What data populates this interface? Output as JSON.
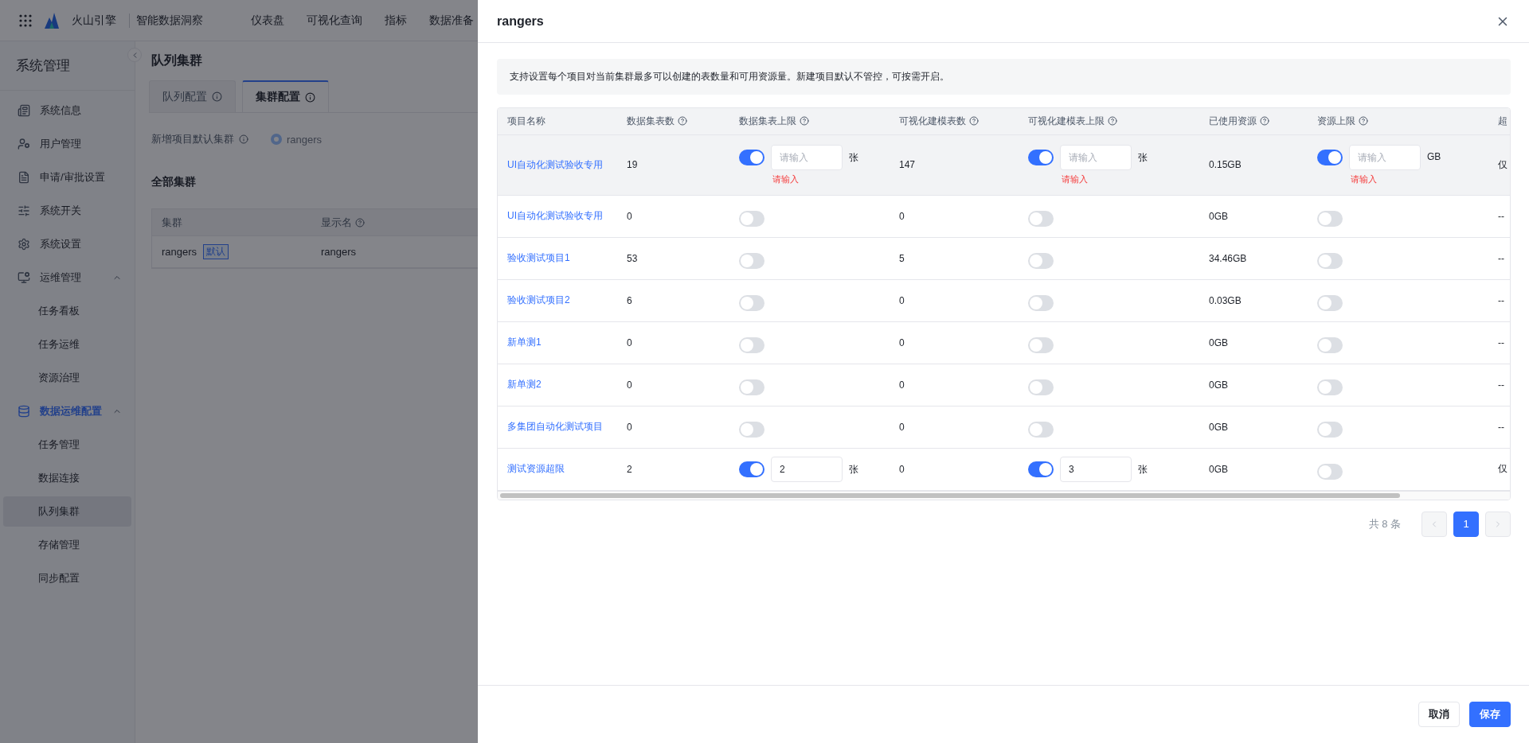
{
  "topbar": {
    "brand": "火山引擎",
    "product": "智能数据洞察",
    "nav": [
      "仪表盘",
      "可视化查询",
      "指标",
      "数据准备"
    ]
  },
  "sidebar": {
    "title": "系统管理",
    "items": [
      {
        "label": "系统信息",
        "selected": false
      },
      {
        "label": "用户管理",
        "selected": false
      },
      {
        "label": "申请/审批设置",
        "selected": false
      },
      {
        "label": "系统开关",
        "selected": false
      },
      {
        "label": "系统设置",
        "selected": false
      },
      {
        "label": "运维管理",
        "expanded": true,
        "active": false,
        "children": [
          {
            "label": "任务看板",
            "selected": false
          },
          {
            "label": "任务运维",
            "selected": false
          },
          {
            "label": "资源治理",
            "selected": false
          }
        ]
      },
      {
        "label": "数据运维配置",
        "expanded": true,
        "active": true,
        "children": [
          {
            "label": "任务管理",
            "selected": false
          },
          {
            "label": "数据连接",
            "selected": false
          },
          {
            "label": "队列集群",
            "selected": true
          },
          {
            "label": "存储管理",
            "selected": false
          },
          {
            "label": "同步配置",
            "selected": false
          }
        ]
      }
    ]
  },
  "main": {
    "title": "队列集群",
    "tabs": [
      {
        "label": "队列配置",
        "selected": false
      },
      {
        "label": "集群配置",
        "selected": true
      }
    ],
    "default_cluster": {
      "label": "新增项目默认集群",
      "options": [
        {
          "label": "rangers",
          "selected": true
        }
      ]
    },
    "section_title": "全部集群",
    "cluster_table": {
      "columns": [
        {
          "label": "集群",
          "help": false
        },
        {
          "label": "显示名",
          "help": true
        }
      ],
      "rows": [
        {
          "name": "rangers",
          "tag": "默认",
          "display_name": "rangers"
        }
      ]
    }
  },
  "drawer": {
    "title": "rangers",
    "notice": "支持设置每个项目对当前集群最多可以创建的表数量和可用资源量。新建项目默认不管控，可按需开启。",
    "table": {
      "columns": [
        {
          "label": "项目名称",
          "help": false
        },
        {
          "label": "数据集表数",
          "help": true
        },
        {
          "label": "数据集表上限",
          "help": true
        },
        {
          "label": "可视化建模表数",
          "help": true
        },
        {
          "label": "可视化建模表上限",
          "help": true
        },
        {
          "label": "已使用资源",
          "help": true
        },
        {
          "label": "资源上限",
          "help": true
        },
        {
          "label": "超"
        }
      ],
      "rows": [
        {
          "name": "UI自动化测试验收专用",
          "highlighted": true,
          "dataset_count": "19",
          "dataset_limit": {
            "on": true,
            "placeholder": "请输入",
            "unit": "张",
            "error": "请输入"
          },
          "model_count": "147",
          "model_limit": {
            "on": true,
            "placeholder": "请输入",
            "unit": "张",
            "error": "请输入"
          },
          "used": "0.15GB",
          "resource_limit": {
            "on": true,
            "placeholder": "请输入",
            "unit": "GB",
            "error": "请输入"
          },
          "column_8": "仅"
        },
        {
          "name": "UI自动化测试验收专用",
          "highlighted": false,
          "dataset_count": "0",
          "dataset_limit": {
            "on": false
          },
          "model_count": "0",
          "model_limit": {
            "on": false
          },
          "used": "0GB",
          "resource_limit": {
            "on": false
          },
          "column_8": "--"
        },
        {
          "name": "验收测试项目1",
          "highlighted": false,
          "dataset_count": "53",
          "dataset_limit": {
            "on": false
          },
          "model_count": "5",
          "model_limit": {
            "on": false
          },
          "used": "34.46GB",
          "resource_limit": {
            "on": false
          },
          "column_8": "--"
        },
        {
          "name": "验收测试项目2",
          "highlighted": false,
          "dataset_count": "6",
          "dataset_limit": {
            "on": false
          },
          "model_count": "0",
          "model_limit": {
            "on": false
          },
          "used": "0.03GB",
          "resource_limit": {
            "on": false
          },
          "column_8": "--"
        },
        {
          "name": "新单测1",
          "highlighted": false,
          "dataset_count": "0",
          "dataset_limit": {
            "on": false
          },
          "model_count": "0",
          "model_limit": {
            "on": false
          },
          "used": "0GB",
          "resource_limit": {
            "on": false
          },
          "column_8": "--"
        },
        {
          "name": "新单测2",
          "highlighted": false,
          "dataset_count": "0",
          "dataset_limit": {
            "on": false
          },
          "model_count": "0",
          "model_limit": {
            "on": false
          },
          "used": "0GB",
          "resource_limit": {
            "on": false
          },
          "column_8": "--"
        },
        {
          "name": "多集团自动化测试项目",
          "highlighted": false,
          "dataset_count": "0",
          "dataset_limit": {
            "on": false
          },
          "model_count": "0",
          "model_limit": {
            "on": false
          },
          "used": "0GB",
          "resource_limit": {
            "on": false
          },
          "column_8": "--"
        },
        {
          "name": "测试资源超限",
          "highlighted": false,
          "dataset_count": "2",
          "dataset_limit": {
            "on": true,
            "value": "2",
            "unit": "张"
          },
          "model_count": "0",
          "model_limit": {
            "on": true,
            "value": "3",
            "unit": "张"
          },
          "used": "0GB",
          "resource_limit": {
            "on": false
          },
          "column_8": "仅"
        }
      ]
    },
    "pagination": {
      "total": "共 8 条",
      "pages": [
        {
          "label": "1",
          "selected": true
        }
      ]
    },
    "buttons": [
      {
        "label": "取消",
        "kind": "secondary"
      },
      {
        "label": "保存",
        "kind": "primary"
      }
    ]
  }
}
